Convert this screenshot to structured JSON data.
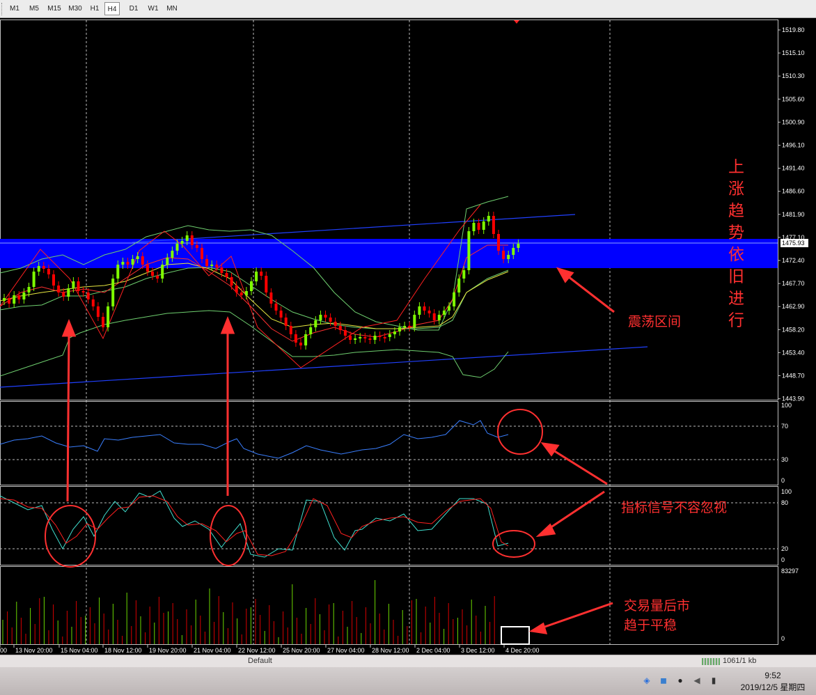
{
  "timeframes": [
    "M1",
    "M5",
    "M15",
    "M30",
    "H1",
    "H4",
    "D1",
    "W1",
    "MN"
  ],
  "active_timeframe": "H4",
  "price_axis": [
    "1519.80",
    "1515.10",
    "1510.30",
    "1505.60",
    "1500.90",
    "1496.10",
    "1491.40",
    "1486.60",
    "1481.90",
    "1477.10",
    "1472.40",
    "1467.70",
    "1462.90",
    "1458.20",
    "1453.40",
    "1448.70",
    "1443.90"
  ],
  "current_price": "1475.93",
  "rsi_axis": [
    "100",
    "70",
    "30",
    "0"
  ],
  "stoch_axis": [
    "100",
    "80",
    "20",
    "0"
  ],
  "volume_axis": [
    "83297",
    "0"
  ],
  "time_axis": [
    "00",
    "13 Nov 20:00",
    "15 Nov 04:00",
    "18 Nov 12:00",
    "19 Nov 20:00",
    "21 Nov 04:00",
    "22 Nov 12:00",
    "25 Nov 20:00",
    "27 Nov 04:00",
    "28 Nov 12:00",
    "2 Dec 04:00",
    "3 Dec 12:00",
    "4 Dec 20:00"
  ],
  "annotations": {
    "trend_vertical": [
      "上",
      "涨",
      "趋",
      "势",
      "依",
      "旧",
      "进",
      "行"
    ],
    "range_label": "震荡区间",
    "signal_label": "指标信号不容忽视",
    "volume_label_line1": "交易量后市",
    "volume_label_line2": "趋于平稳"
  },
  "status": {
    "profile": "Default",
    "traffic": "1061/1 kb"
  },
  "clock": {
    "time": "9:52",
    "date": "2019/12/5 星期四"
  },
  "colors": {
    "background": "#000000",
    "bull_candle": "#7fff00",
    "bear_candle": "#ff0000",
    "zone": "#0000ff",
    "annotation": "#ff3030",
    "bollinger": "#90ee90",
    "trendline": "#1f3fff",
    "rsi": "#3a7fff",
    "stoch_main": "#40e0d0",
    "stoch_signal": "#ff2020"
  }
}
